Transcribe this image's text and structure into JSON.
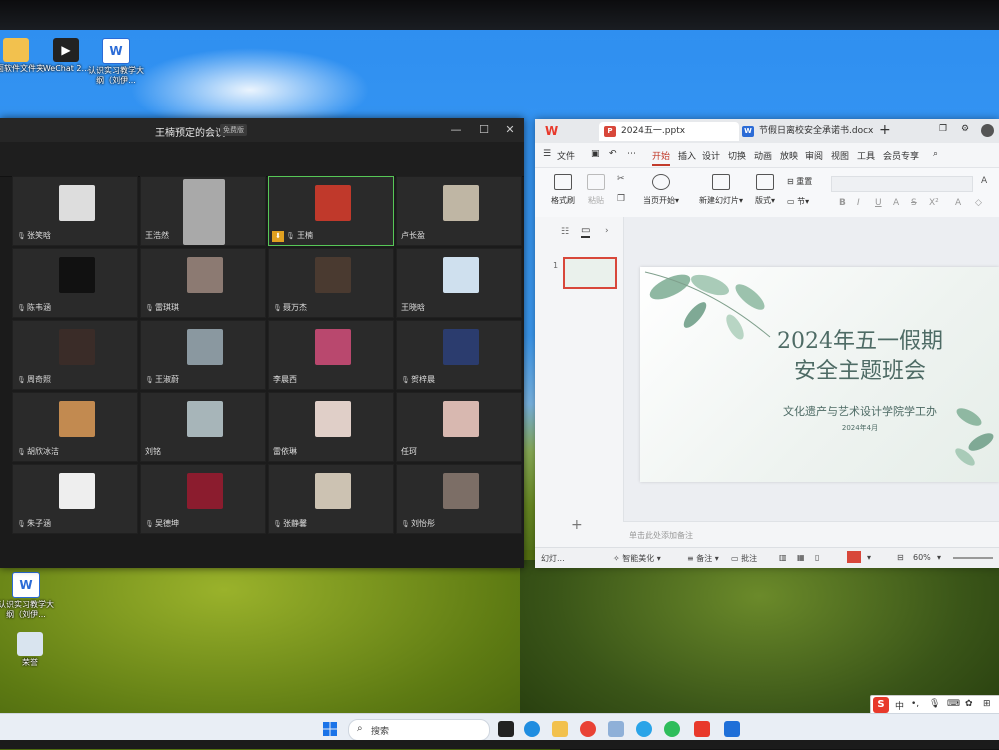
{
  "desktop": {
    "icons_top": [
      {
        "label": "桌面软件文件夹",
        "color": "#f2c14e"
      },
      {
        "label": "WeChat 2...",
        "color": "#222"
      },
      {
        "label": "认识实习教学大纲（刘伊...",
        "color": "#2b6bd6"
      }
    ],
    "icons_bottom": [
      {
        "label": "认识实习教学大纲（刘伊...",
        "color": "#2b6bd6"
      },
      {
        "label": "荣誉",
        "color": "#d9e4ef"
      }
    ]
  },
  "meeting": {
    "title": "王楠预定的会议",
    "badge": "免费版",
    "participants": [
      {
        "name": "张笑晗",
        "color": "#ddd",
        "muted": true
      },
      {
        "name": "王浩然",
        "color": "#a9a9a9",
        "muted": false,
        "tall": true
      },
      {
        "name": "王楠",
        "color": "#c0392b",
        "muted": true,
        "host": true,
        "active": true
      },
      {
        "name": "卢长盈",
        "color": "#bfb6a4",
        "muted": false
      },
      {
        "name": "陈韦涵",
        "color": "#111",
        "muted": true
      },
      {
        "name": "雷琪琪",
        "color": "#8c7a72",
        "muted": true
      },
      {
        "name": "聂万杰",
        "color": "#4a3a30",
        "muted": true
      },
      {
        "name": "王晓晗",
        "color": "#cfe0ee",
        "muted": false
      },
      {
        "name": "周奇照",
        "color": "#3a2c28",
        "muted": true
      },
      {
        "name": "王淑蔚",
        "color": "#8a98a0",
        "muted": true
      },
      {
        "name": "李晨西",
        "color": "#b9486e",
        "muted": false
      },
      {
        "name": "贺梓晨",
        "color": "#2b3c6e",
        "muted": true
      },
      {
        "name": "胡欣冰洁",
        "color": "#c28a50",
        "muted": true
      },
      {
        "name": "刘铭",
        "color": "#a7b5b9",
        "muted": false
      },
      {
        "name": "雷依琳",
        "color": "#e0cfc8",
        "muted": false
      },
      {
        "name": "任珂",
        "color": "#d8b8b0",
        "muted": false
      },
      {
        "name": "朱子涵",
        "color": "#eee",
        "muted": true
      },
      {
        "name": "吴德坤",
        "color": "#8b1c2e",
        "muted": true
      },
      {
        "name": "张静馨",
        "color": "#ccc2b2",
        "muted": true
      },
      {
        "name": "刘怡彤",
        "color": "#7c6e66",
        "muted": true
      }
    ]
  },
  "wps": {
    "logo": "W",
    "tabs": [
      {
        "label": "2024五一.pptx",
        "icon": "P",
        "color": "#d8473a"
      },
      {
        "label": "节假日离校安全承诺书.docx",
        "icon": "W",
        "color": "#2b6bd6"
      }
    ],
    "menu": [
      "文件",
      "开始",
      "插入",
      "设计",
      "切换",
      "动画",
      "放映",
      "审阅",
      "视图",
      "工具",
      "会员专享"
    ],
    "ribbon": {
      "format_painter": "格式刷",
      "paste": "粘贴",
      "play_from": "当页开始",
      "new_slide": "新建幻灯片",
      "layout": "版式",
      "section": "节",
      "reset": "重置"
    },
    "slide_number": "1",
    "slide": {
      "title_line1": "2024年五一假期",
      "title_line2": "安全主题班会",
      "subtitle": "文化遗产与艺术设计学院学工办",
      "date": "2024年4月"
    },
    "notes_placeholder": "单击此处添加备注",
    "status": {
      "slide": "幻灯...",
      "smart": "智能美化",
      "notes": "备注",
      "comments": "批注",
      "zoom": "60%"
    }
  },
  "taskbar": {
    "search_placeholder": "搜索",
    "ime_lang": "中"
  }
}
